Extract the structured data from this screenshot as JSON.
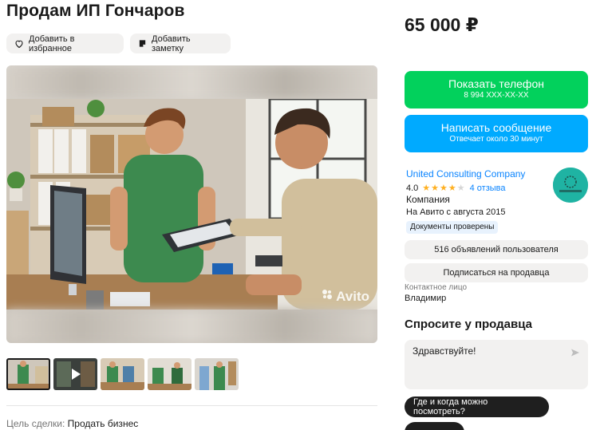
{
  "listing": {
    "title": "Продам ИП Гончаров",
    "price": "65 000 ₽",
    "favorite_label": "Добавить в избранное",
    "note_label": "Добавить заметку",
    "watermark": "Avito",
    "deal_label": "Цель сделки:",
    "deal_value": "Продать бизнес"
  },
  "gallery": {
    "thumbnail_count": 5,
    "active_thumbnail": 0,
    "video_thumbnail": 1
  },
  "contact": {
    "phone_button": "Показать телефон",
    "phone_masked": "8 994 XXX-XX-XX",
    "message_button": "Написать сообщение",
    "response_time": "Отвечает около 30 минут"
  },
  "seller": {
    "name": "United Consulting Company",
    "rating": "4.0",
    "rating_value": 4,
    "rating_max": 5,
    "reviews": "4 отзыва",
    "type": "Компания",
    "since": "На Авито с августа 2015",
    "docs_badge": "Документы проверены",
    "ads_button": "516 объявлений пользователя",
    "subscribe_button": "Подписаться на продавца",
    "contact_label": "Контактное лицо",
    "contact_name": "Владимир",
    "avatar_color": "#1fb3a3"
  },
  "ask": {
    "title": "Спросите у продавца",
    "message": "Здравствуйте!",
    "quick_question_1": "Где и когда можно посмотреть?"
  },
  "colors": {
    "green": "#02d15c",
    "blue": "#00aaff",
    "link": "#0a84ff",
    "star": "#ffb021"
  }
}
